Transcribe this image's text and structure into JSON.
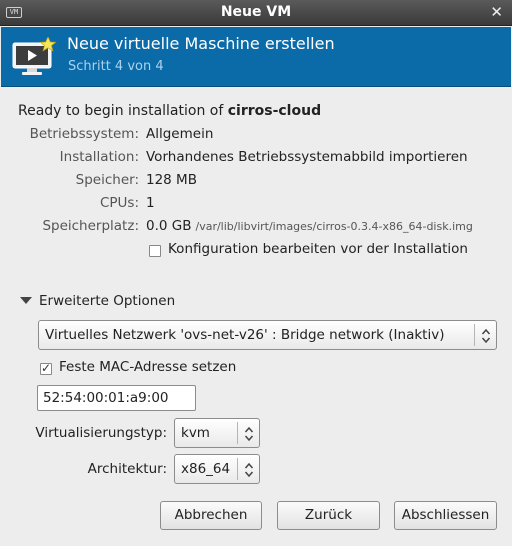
{
  "window": {
    "title": "Neue VM",
    "app_icon_text": "VM",
    "close_glyph": "✕"
  },
  "header": {
    "title": "Neue virtuelle Maschine erstellen",
    "step": "Schritt 4 von 4",
    "icon": "monitor-star-icon",
    "background_color": "#0b6aa8"
  },
  "summary": {
    "ready_prefix": "Ready to begin installation of",
    "vm_name": "cirros-cloud",
    "rows": [
      {
        "label": "Betriebssystem:",
        "value": "Allgemein"
      },
      {
        "label": "Installation:",
        "value": "Vorhandenes Betriebssystemabbild importieren"
      },
      {
        "label": "Speicher:",
        "value": "128 MB"
      },
      {
        "label": "CPUs:",
        "value": "1"
      },
      {
        "label": "Speicherplatz:",
        "value": "0.0 GB",
        "path": "/var/lib/libvirt/images/cirros-0.3.4-x86_64-disk.img"
      }
    ],
    "edit_config_label": "Konfiguration bearbeiten vor der Installation",
    "edit_config_checked": false
  },
  "advanced": {
    "expander_label": "Erweiterte Optionen",
    "network_selected": "Virtuelles Netzwerk 'ovs-net-v26' : Bridge network (Inaktiv)",
    "fixed_mac_label": "Feste MAC-Adresse setzen",
    "fixed_mac_checked": true,
    "mac_address": "52:54:00:01:a9:00",
    "virt_type_label": "Virtualisierungstyp:",
    "virt_type_value": "kvm",
    "arch_label": "Architektur:",
    "arch_value": "x86_64"
  },
  "buttons": {
    "cancel": "Abbrechen",
    "back": "Zurück",
    "finish": "Abschliessen"
  }
}
